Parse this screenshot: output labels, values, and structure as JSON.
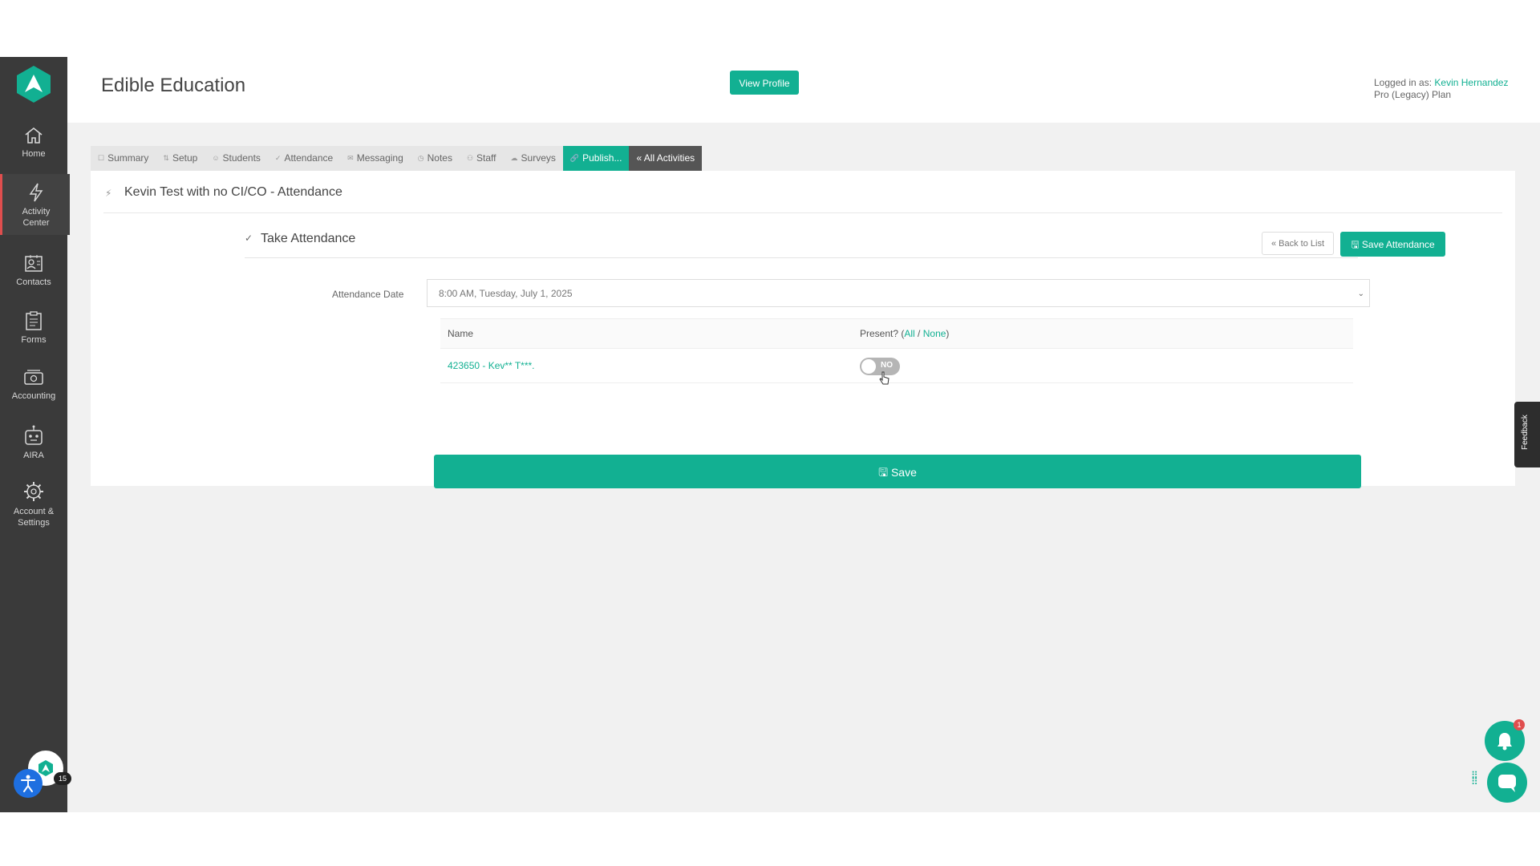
{
  "sidebar": {
    "items": [
      {
        "label": "Home",
        "icon": "home-icon"
      },
      {
        "label": "Activity\nCenter",
        "icon": "bolt-icon"
      },
      {
        "label": "Contacts",
        "icon": "contacts-icon"
      },
      {
        "label": "Forms",
        "icon": "clipboard-icon"
      },
      {
        "label": "Accounting",
        "icon": "money-icon"
      },
      {
        "label": "AIRA",
        "icon": "robot-icon"
      },
      {
        "label": "Account &\nSettings",
        "icon": "gear-icon"
      }
    ],
    "avatar_badge": "15"
  },
  "header": {
    "title": "Edible Education",
    "view_profile": "View Profile",
    "logged_in_prefix": "Logged in as:",
    "user_name": "Kevin Hernandez",
    "plan": "Pro (Legacy) Plan"
  },
  "tabs": [
    {
      "label": "Summary",
      "icon": "☐"
    },
    {
      "label": "Setup",
      "icon": "⇅"
    },
    {
      "label": "Students",
      "icon": "☺"
    },
    {
      "label": "Attendance",
      "icon": "✓"
    },
    {
      "label": "Messaging",
      "icon": "✉"
    },
    {
      "label": "Notes",
      "icon": "◷"
    },
    {
      "label": "Staff",
      "icon": "⚇"
    },
    {
      "label": "Surveys",
      "icon": "☁"
    },
    {
      "label": "Publish...",
      "icon": "🔗"
    },
    {
      "label": "« All Activities",
      "icon": ""
    }
  ],
  "activity": {
    "title": "Kevin Test with no CI/CO - Attendance"
  },
  "take_attendance": {
    "title": "Take Attendance",
    "back_to_list": "« Back to List",
    "save_attendance": "Save Attendance",
    "date_label": "Attendance Date",
    "date_value": "8:00 AM, Tuesday, July 1, 2025",
    "table": {
      "col_name": "Name",
      "col_present": "Present?",
      "all_link": "All",
      "none_link": "None",
      "rows": [
        {
          "student": "423650 - Kev** T***.",
          "present": "NO"
        }
      ]
    },
    "save_button": "Save"
  },
  "feedback": "Feedback",
  "notifications": {
    "badge": "1"
  },
  "colors": {
    "accent": "#12b092",
    "sidebar": "#3a3a3a",
    "badge": "#e04e4e"
  }
}
